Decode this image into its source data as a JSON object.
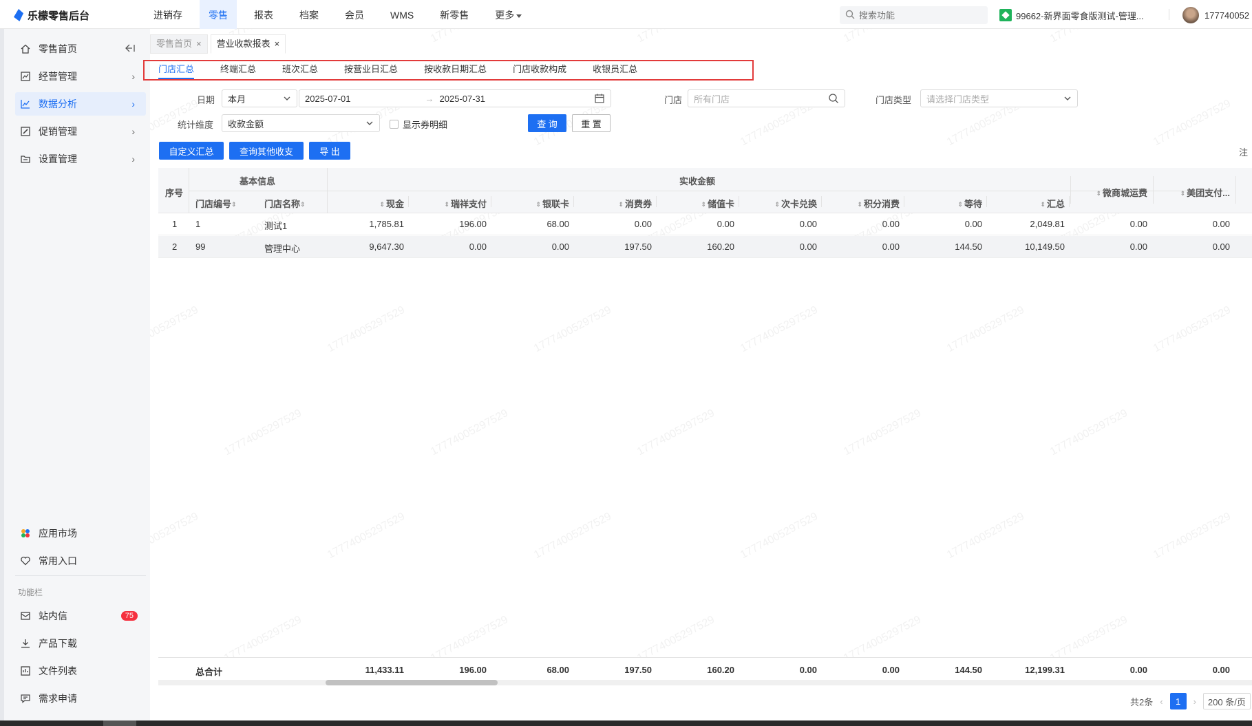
{
  "header": {
    "logo_text": "乐檬零售后台",
    "nav": [
      {
        "label": "进销存"
      },
      {
        "label": "零售"
      },
      {
        "label": "报表"
      },
      {
        "label": "档案"
      },
      {
        "label": "会员"
      },
      {
        "label": "WMS"
      },
      {
        "label": "新零售"
      },
      {
        "label": "更多"
      }
    ],
    "active_nav": "零售",
    "search_placeholder": "搜索功能",
    "store": "99662-新界面零食版测试-管理...",
    "user": "177740052"
  },
  "sidebar": {
    "items": [
      {
        "label": "零售首页",
        "icon": "home-icon"
      },
      {
        "label": "经营管理",
        "icon": "chart-box-icon"
      },
      {
        "label": "数据分析",
        "icon": "trend-icon"
      },
      {
        "label": "促销管理",
        "icon": "promo-icon"
      },
      {
        "label": "设置管理",
        "icon": "folder-icon"
      }
    ],
    "bottom_items": [
      {
        "label": "应用市场",
        "icon": "app-market-icon"
      },
      {
        "label": "常用入口",
        "icon": "heart-icon"
      }
    ],
    "section_label": "功能栏",
    "func_items": [
      {
        "label": "站内信",
        "icon": "mail-icon",
        "badge": "75"
      },
      {
        "label": "产品下载",
        "icon": "download-icon"
      },
      {
        "label": "文件列表",
        "icon": "file-list-icon"
      },
      {
        "label": "需求申请",
        "icon": "request-icon"
      }
    ]
  },
  "page_tabs": [
    {
      "label": "零售首页"
    },
    {
      "label": "营业收款报表"
    }
  ],
  "sub_tabs": [
    {
      "label": "门店汇总"
    },
    {
      "label": "终端汇总"
    },
    {
      "label": "班次汇总"
    },
    {
      "label": "按营业日汇总"
    },
    {
      "label": "按收款日期汇总"
    },
    {
      "label": "门店收款构成"
    },
    {
      "label": "收银员汇总"
    }
  ],
  "filters": {
    "date_label": "日期",
    "date_range": "本月",
    "date_start": "2025-07-01",
    "date_end": "2025-07-31",
    "store_label": "门店",
    "store_placeholder": "所有门店",
    "store_type_label": "门店类型",
    "store_type_placeholder": "请选择门店类型",
    "dimension_label": "统计维度",
    "dimension_value": "收款金额",
    "show_coupon_detail": "显示券明细",
    "query_btn": "查 询",
    "reset_btn": "重 置"
  },
  "actions": {
    "custom_summary": "自定义汇总",
    "query_other": "查询其他收支",
    "export": "导 出",
    "note": "注"
  },
  "table": {
    "group_basic": "基本信息",
    "group_received": "实收金额",
    "col_index": "序号",
    "col_store_code": "门店编号",
    "col_store_name": "门店名称",
    "amount_cols": [
      "现金",
      "瑞祥支付",
      "银联卡",
      "消费券",
      "储值卡",
      "次卡兑换",
      "积分消费",
      "等待",
      "汇总"
    ],
    "extra_cols": [
      "微商城运费",
      "美团支付..."
    ],
    "rows": [
      {
        "index": "1",
        "code": "1",
        "name": "测试1",
        "values": [
          "1,785.81",
          "196.00",
          "68.00",
          "0.00",
          "0.00",
          "0.00",
          "0.00",
          "0.00",
          "2,049.81",
          "0.00",
          "0.00"
        ]
      },
      {
        "index": "2",
        "code": "99",
        "name": "管理中心",
        "values": [
          "9,647.30",
          "0.00",
          "0.00",
          "197.50",
          "160.20",
          "0.00",
          "0.00",
          "144.50",
          "10,149.50",
          "0.00",
          "0.00"
        ]
      }
    ],
    "total_label": "总合计",
    "totals": [
      "11,433.11",
      "196.00",
      "68.00",
      "197.50",
      "160.20",
      "0.00",
      "0.00",
      "144.50",
      "12,199.31",
      "0.00",
      "0.00"
    ]
  },
  "pager": {
    "total": "共2条",
    "current": "1",
    "page_size": "200 条/页"
  },
  "watermark": "17774005297529"
}
